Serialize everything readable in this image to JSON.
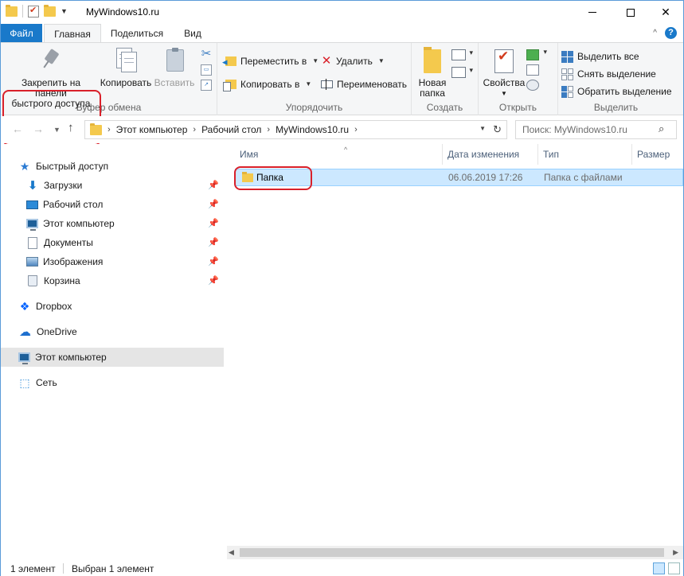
{
  "window": {
    "title": "MyWindows10.ru"
  },
  "tabs": {
    "file": "Файл",
    "home": "Главная",
    "share": "Поделиться",
    "view": "Вид",
    "help": "?"
  },
  "ribbon": {
    "clipboard": {
      "label": "Буфер обмена",
      "pin_line1": "Закрепить на панели",
      "pin_line2": "быстрого доступа",
      "copy": "Копировать",
      "paste": "Вставить"
    },
    "organize": {
      "label": "Упорядочить",
      "move": "Переместить в",
      "copy_to": "Копировать в",
      "delete": "Удалить",
      "rename": "Переименовать"
    },
    "new": {
      "label": "Создать",
      "new_folder_line1": "Новая",
      "new_folder_line2": "папка"
    },
    "open": {
      "label": "Открыть",
      "properties": "Свойства"
    },
    "select": {
      "label": "Выделить",
      "select_all": "Выделить все",
      "select_none": "Снять выделение",
      "invert": "Обратить выделение"
    }
  },
  "address": {
    "crumbs": [
      "Этот компьютер",
      "Рабочий стол",
      "MyWindows10.ru"
    ],
    "search_placeholder": "Поиск: MyWindows10.ru"
  },
  "nav": {
    "quick_access": "Быстрый доступ",
    "downloads": "Загрузки",
    "desktop": "Рабочий стол",
    "this_pc_pinned": "Этот компьютер",
    "documents": "Документы",
    "images": "Изображения",
    "recycle_bin": "Корзина",
    "dropbox": "Dropbox",
    "onedrive": "OneDrive",
    "this_pc": "Этот компьютер",
    "network": "Сеть"
  },
  "columns": {
    "name": "Имя",
    "date": "Дата изменения",
    "type": "Тип",
    "size": "Размер"
  },
  "files": [
    {
      "name": "Папка",
      "date": "06.06.2019 17:26",
      "type": "Папка с файлами"
    }
  ],
  "status": {
    "count": "1 элемент",
    "selected": "Выбран 1 элемент"
  },
  "colors": {
    "accent": "#1979ca",
    "highlight_ring": "#d9202a",
    "selection": "#cce8ff"
  }
}
